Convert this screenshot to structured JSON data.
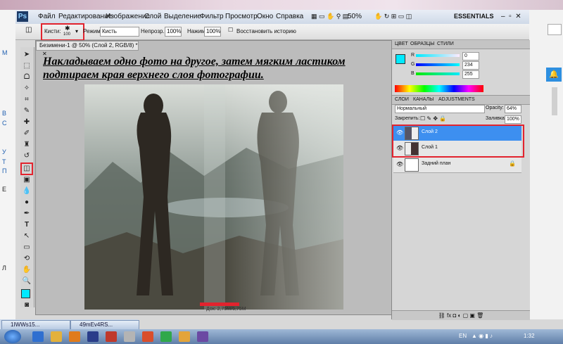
{
  "menu": {
    "app_logo": "Ps",
    "items": [
      "Файл",
      "Редактирование",
      "Изображение",
      "Слой",
      "Выделение",
      "Фильтр",
      "Просмотр",
      "Окно",
      "Справка"
    ],
    "zoom": "50%",
    "workspace": "ESSENTIALS"
  },
  "options": {
    "brush_label": "Кисти:",
    "brush_size": "100",
    "mode_label": "Режим:",
    "mode_value": "Кисть",
    "opacity_label": "Непрозр.:",
    "opacity_value": "100%",
    "pressure_label": "Нажим:",
    "pressure_value": "100%",
    "history_label": "Восстановить историю"
  },
  "document": {
    "tab_title": "Безимени-1 @ 50% (Слой 2, RGB/8) *",
    "caption_line1": "Накладываем одно фото на другое, затем мягким ластиком",
    "caption_line2": "подтираем края верхнего слоя фотографии.",
    "status": "Док: 2,75M/5,75M"
  },
  "color_panel": {
    "tabs": [
      "ЦВЕТ",
      "ОБРАЗЦЫ",
      "СТИЛИ"
    ],
    "r_label": "R",
    "r_value": "0",
    "g_label": "G",
    "g_value": "234",
    "b_label": "B",
    "b_value": "255",
    "swatch_color": "#00eaff"
  },
  "layers_panel": {
    "tabs": [
      "СЛОИ",
      "КАНАЛЫ",
      "ADJUSTMENTS"
    ],
    "blend_mode": "Нормальный",
    "opacity_label": "Opacity:",
    "opacity_value": "64%",
    "lock_label": "Закрепить:",
    "fill_label": "Заливка:",
    "fill_value": "100%",
    "layers": [
      {
        "name": "Слой 2"
      },
      {
        "name": "Слой 1"
      },
      {
        "name": "Задний план"
      }
    ]
  },
  "left_strip": [
    "М",
    "В",
    "С",
    "У",
    "Т",
    "П",
    "Е",
    "Л"
  ],
  "taskbar": {
    "tabs": [
      "1IWWs15...",
      "49mEv4RS..."
    ],
    "lang": "EN",
    "time": "1:32"
  },
  "colors": {
    "accent": "#e2232e",
    "selected_layer": "#3d8ff0"
  }
}
